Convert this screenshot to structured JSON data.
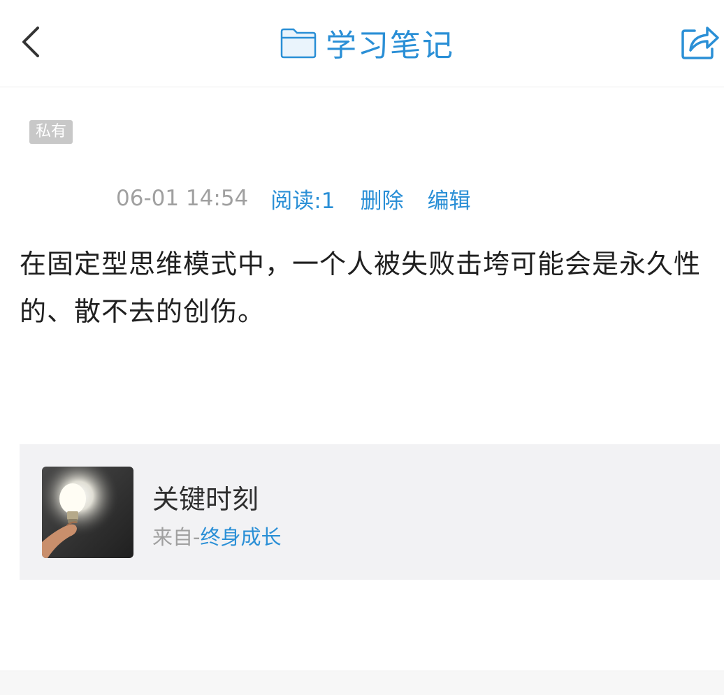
{
  "header": {
    "title": "学习笔记",
    "back_icon": "chevron-left-icon",
    "folder_icon": "folder-icon",
    "share_icon": "share-icon",
    "accent_color": "#2a8fd6"
  },
  "note": {
    "privacy_badge": "私有",
    "time": "06-01 14:54",
    "read_count": "阅读:1",
    "delete_label": "删除",
    "edit_label": "编辑",
    "content": "在固定型思维模式中，一个人被失败击垮可能会是永久性的、散不去的创伤。"
  },
  "source_card": {
    "title": "关键时刻",
    "from_prefix": "来自-",
    "from_source": "终身成长",
    "thumbnail": "lightbulb-image"
  }
}
